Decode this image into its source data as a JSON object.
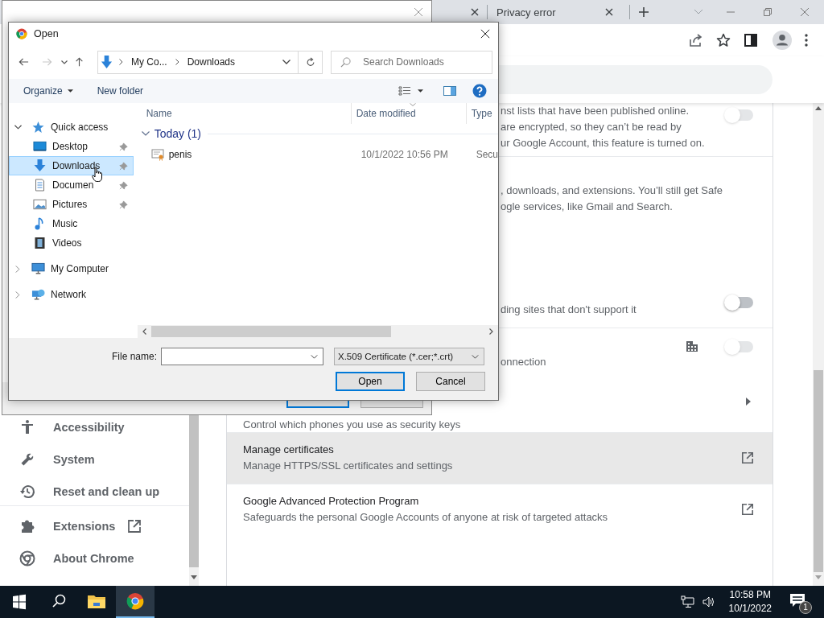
{
  "browser": {
    "tabs": [
      {
        "label": "Privacy error",
        "selected": false
      }
    ]
  },
  "settings_nav": [
    {
      "label": "Accessibility"
    },
    {
      "label": "System"
    },
    {
      "label": "Reset and clean up"
    }
  ],
  "settings_nav_links": [
    {
      "label": "Extensions",
      "external": true
    },
    {
      "label": "About Chrome",
      "external": false
    }
  ],
  "settings_rows": [
    {
      "kind": "toggle",
      "lines": [
        "nst lists that have been published online.",
        "are encrypted, so they can’t be read by",
        "ur Google Account, this feature is turned on."
      ],
      "on": false,
      "disabled": true,
      "managed": false
    },
    {
      "kind": "text",
      "lines": [
        ", downloads, and extensions. You’ll still get Safe",
        "ogle services, like Gmail and Search."
      ]
    },
    {
      "kind": "toggle",
      "lines": [
        "ding sites that don't support it"
      ],
      "on": false,
      "disabled": false,
      "managed": false
    },
    {
      "kind": "toggle",
      "lines": [
        "onnection"
      ],
      "on": false,
      "disabled": true,
      "managed": true
    },
    {
      "kind": "arrow",
      "lines": [
        "Control which phones you use as security keys"
      ]
    },
    {
      "kind": "link",
      "title": "Manage certificates",
      "subtitle": "Manage HTTPS/SSL certificates and settings",
      "highlighted": true
    },
    {
      "kind": "link",
      "title": "Google Advanced Protection Program",
      "subtitle": "Safeguards the personal Google Accounts of anyone at risk of targeted attacks",
      "highlighted": false
    }
  ],
  "wizard": {
    "buttons": [
      {
        "default": true
      },
      {
        "default": false
      }
    ]
  },
  "open_dialog": {
    "title": "Open",
    "breadcrumb": [
      "My Co...",
      "Downloads"
    ],
    "search": {
      "placeholder": "Search Downloads"
    },
    "organize": "Organize",
    "new_folder": "New folder",
    "tree": [
      {
        "label": "Quick access",
        "expanded": true,
        "selected": false,
        "children": [
          {
            "label": "Desktop",
            "pinned": true,
            "selected": false
          },
          {
            "label": "Downloads",
            "pinned": true,
            "selected": true
          },
          {
            "label": "Documen",
            "pinned": true,
            "selected": false
          },
          {
            "label": "Pictures",
            "pinned": true,
            "selected": false
          },
          {
            "label": "Music",
            "pinned": false,
            "selected": false
          },
          {
            "label": "Videos",
            "pinned": false,
            "selected": false
          }
        ]
      },
      {
        "label": "My Computer",
        "expanded": false,
        "selected": false
      },
      {
        "label": "Network",
        "expanded": false,
        "selected": false
      }
    ],
    "columns": [
      "Name",
      "Date modified",
      "Type"
    ],
    "groups": [
      {
        "label": "Today (1)",
        "expanded": true,
        "files": [
          {
            "name": "penis",
            "date": "10/1/2022 10:56 PM",
            "type": "Secu"
          }
        ]
      }
    ],
    "file_name_label": "File name:",
    "filter": "X.509 Certificate (*.cer;*.crt)",
    "buttons": [
      {
        "label": "Open",
        "default": true
      },
      {
        "label": "Cancel",
        "default": false
      }
    ]
  },
  "taskbar": {
    "apps": [
      {
        "kind": "explorer",
        "active": false
      },
      {
        "kind": "chrome",
        "active": true
      }
    ],
    "time": "10:58 PM",
    "date": "10/1/2022",
    "notifications": "1"
  }
}
